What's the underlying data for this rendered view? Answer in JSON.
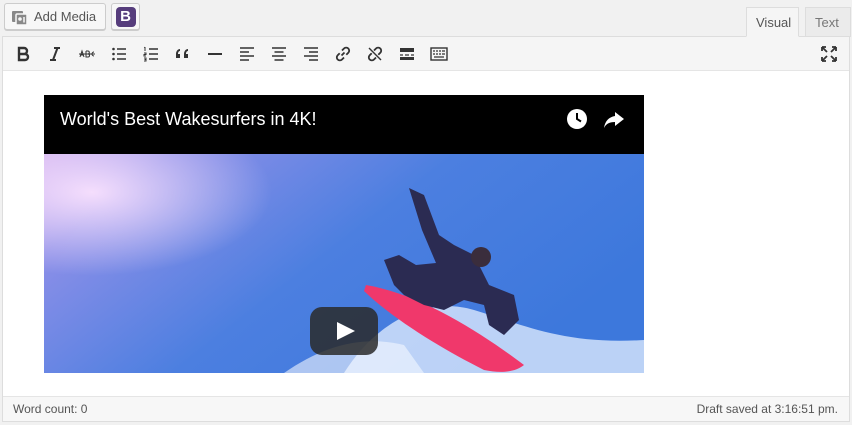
{
  "media_bar": {
    "add_media_label": "Add Media",
    "bootstrap_letter": "B",
    "bootstrap_color": "#563d7c"
  },
  "tabs": [
    {
      "label": "Visual",
      "active": true
    },
    {
      "label": "Text",
      "active": false
    }
  ],
  "toolbar": {
    "buttons": [
      {
        "name": "bold-icon"
      },
      {
        "name": "italic-icon"
      },
      {
        "name": "strikethrough-icon"
      },
      {
        "name": "bulleted-list-icon"
      },
      {
        "name": "numbered-list-icon"
      },
      {
        "name": "blockquote-icon"
      },
      {
        "name": "horizontal-line-icon"
      },
      {
        "name": "align-left-icon"
      },
      {
        "name": "align-center-icon"
      },
      {
        "name": "align-right-icon"
      },
      {
        "name": "insert-link-icon"
      },
      {
        "name": "remove-link-icon"
      },
      {
        "name": "read-more-icon"
      },
      {
        "name": "toolbar-toggle-icon"
      },
      {
        "name": "fullscreen-icon"
      }
    ]
  },
  "video": {
    "title": "World's Best Wakesurfers in 4K!",
    "header_color": "#000000",
    "sky_color": "#3a73d6"
  },
  "status": {
    "word_count": "Word count: 0",
    "draft_saved": "Draft saved at 3:16:51 pm."
  }
}
